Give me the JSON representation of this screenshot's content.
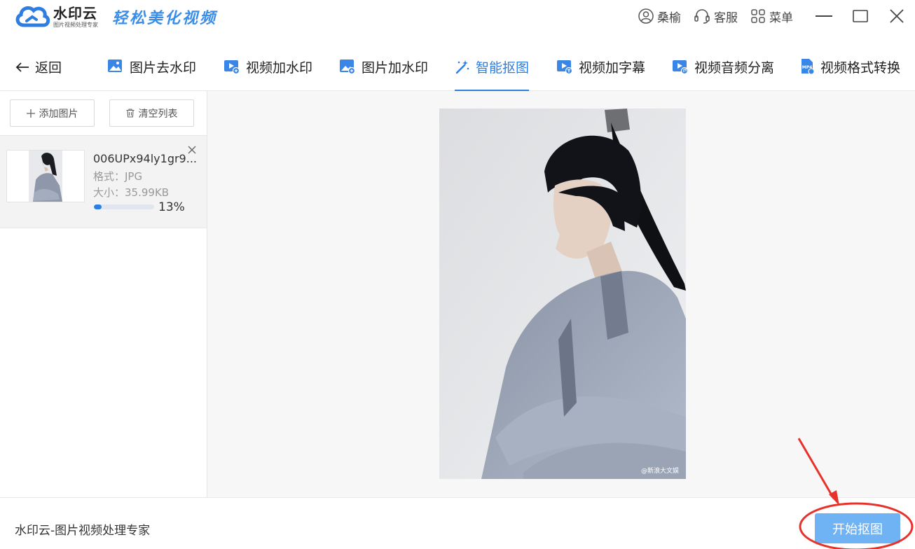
{
  "app": {
    "logo_name": "水印云",
    "logo_sub": "图片视频处理专家",
    "slogan": "轻松美化视频"
  },
  "titlebar": {
    "user": "桑榆",
    "service": "客服",
    "menu": "菜单"
  },
  "nav": {
    "back": "返回",
    "tabs": [
      {
        "label": "图片去水印",
        "icon": "image-icon"
      },
      {
        "label": "视频加水印",
        "icon": "video-plus-icon"
      },
      {
        "label": "图片加水印",
        "icon": "image-plus-icon"
      },
      {
        "label": "智能抠图",
        "icon": "magic-wand-icon",
        "active": true
      },
      {
        "label": "视频加字幕",
        "icon": "video-text-icon"
      },
      {
        "label": "视频音频分离",
        "icon": "video-audio-icon"
      },
      {
        "label": "视频格式转换",
        "icon": "mp4-icon"
      }
    ]
  },
  "sidebar": {
    "add_label": "添加图片",
    "clear_label": "清空列表",
    "file": {
      "name": "006UPx94ly1gr9...",
      "format": "格式：JPG",
      "size": "大小：35.99KB",
      "progress_percent": 13,
      "progress_text": "13%"
    }
  },
  "preview": {
    "watermark": "@新浪大文娱"
  },
  "footer": {
    "text": "水印云-图片视频处理专家",
    "start_label": "开始抠图"
  },
  "colors": {
    "accent": "#2e7de1",
    "start_button": "#6fb3f5",
    "annotation": "#e8312a"
  }
}
